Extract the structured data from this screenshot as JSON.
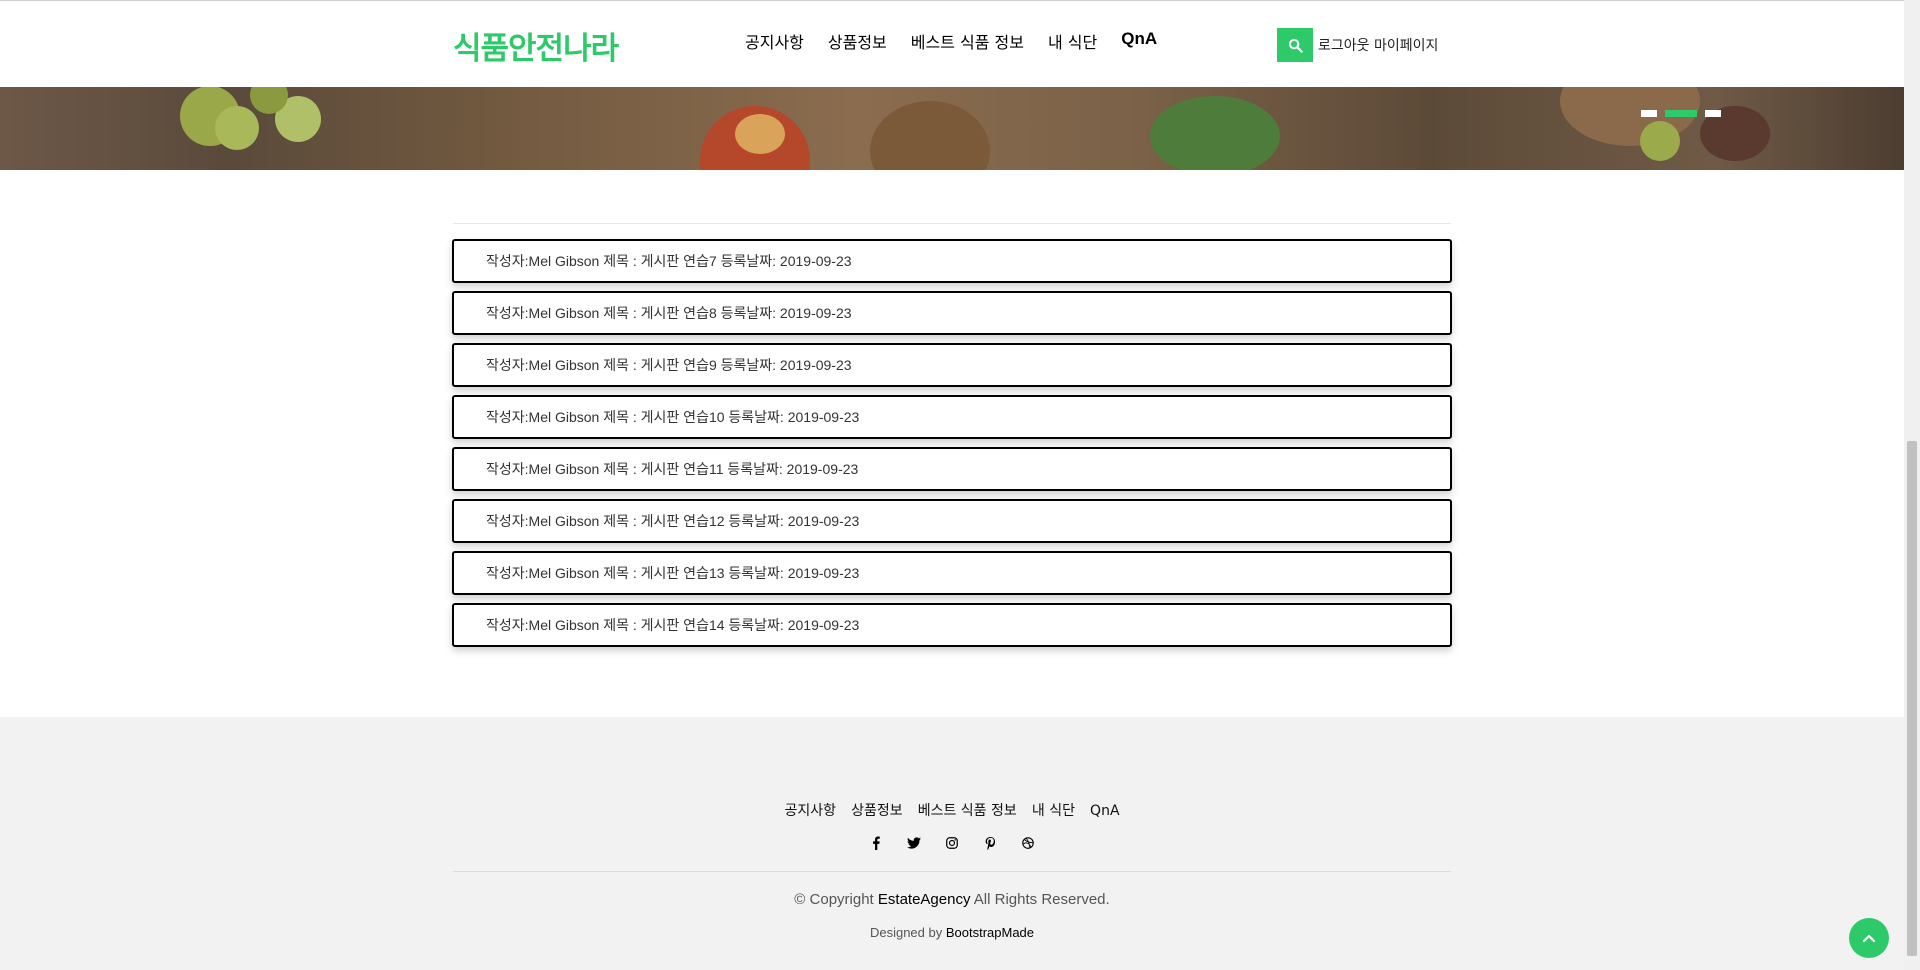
{
  "brand": "식품안전나라",
  "nav": {
    "items": [
      "공지사항",
      "상품정보",
      "베스트 식품 정보",
      "내 식단",
      "QnA"
    ]
  },
  "auth": {
    "logout": "로그아웃",
    "mypage": "마이페이지"
  },
  "carousel": {
    "active_index": 1,
    "count": 3
  },
  "posts": [
    {
      "icon": "",
      "text": "작성자:Mel Gibson 제목 : 게시판 연습7 등록날짜: 2019-09-23"
    },
    {
      "icon": "",
      "text": "작성자:Mel Gibson 제목 : 게시판 연습8 등록날짜: 2019-09-23"
    },
    {
      "icon": "",
      "text": "작성자:Mel Gibson 제목 : 게시판 연습9 등록날짜: 2019-09-23"
    },
    {
      "icon": "",
      "text": "작성자:Mel Gibson 제목 : 게시판 연습10 등록날짜: 2019-09-23"
    },
    {
      "icon": "",
      "text": "작성자:Mel Gibson 제목 : 게시판 연습11 등록날짜: 2019-09-23"
    },
    {
      "icon": "",
      "text": "작성자:Mel Gibson 제목 : 게시판 연습12 등록날짜: 2019-09-23"
    },
    {
      "icon": "",
      "text": "작성자:Mel Gibson 제목 : 게시판 연습13 등록날짜: 2019-09-23"
    },
    {
      "icon": "",
      "text": "작성자:Mel Gibson 제목 : 게시판 연습14 등록날짜: 2019-09-23"
    }
  ],
  "footer": {
    "nav": [
      "공지사항",
      "상품정보",
      "베스트 식품 정보",
      "내 식단",
      "QnA"
    ],
    "socials": [
      "facebook-icon",
      "twitter-icon",
      "instagram-icon",
      "pinterest-icon",
      "dribbble-icon"
    ],
    "copyright_prefix": "© Copyright ",
    "copyright_brand": "EstateAgency",
    "copyright_suffix": " All Rights Reserved.",
    "designed_prefix": "Designed by ",
    "designed_link": "BootstrapMade"
  },
  "colors": {
    "accent": "#2eca6a"
  }
}
